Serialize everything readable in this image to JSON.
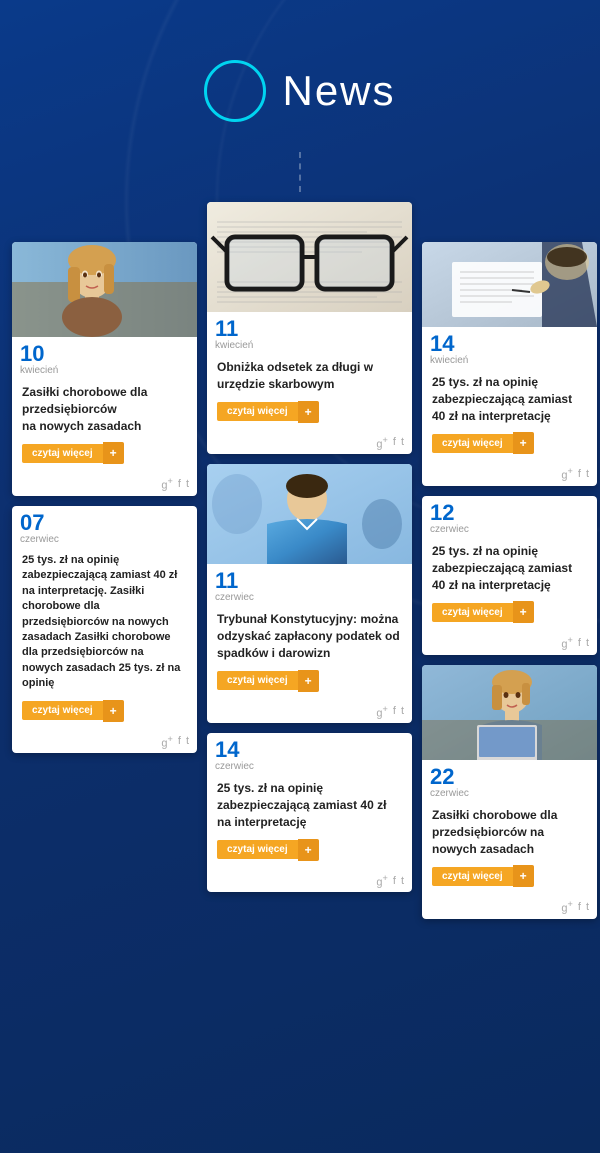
{
  "header": {
    "title": "News",
    "circle_color": "#00c8e0"
  },
  "cards": {
    "card1": {
      "day": "10",
      "month": "kwiecień",
      "title": "Zasiłki chorobowe dla przedsiębiorców na nowych zasadach",
      "read_more": "czytaj więcej",
      "plus": "+",
      "socials": [
        "g+",
        "f",
        "t"
      ]
    },
    "card2": {
      "day": "11",
      "month": "kwiecień",
      "title": "Obniżka odsetek za długi w urzędzie skarbowym",
      "read_more": "czytaj więcej",
      "plus": "+",
      "socials": [
        "g+",
        "f",
        "t"
      ]
    },
    "card3": {
      "day": "14",
      "month": "kwiecień",
      "title": "25 tys. zł na opinię zabezpieczającą zamiast 40 zł na interpretację",
      "read_more": "czytaj więcej",
      "plus": "+",
      "socials": [
        "g+",
        "f",
        "t"
      ]
    },
    "card4": {
      "day": "07",
      "month": "czerwiec",
      "title": "25 tys. zł na opinię zabezpieczającą zamiast 40 zł na interpretację. Zasiłki chorobowe dla przedsiębiorców na nowych zasadach Zasiłki chorobowe dla przedsiębiorców na nowych zasadach 25 tys. zł na opinię",
      "read_more": "czytaj więcej",
      "plus": "+",
      "socials": [
        "g+",
        "f",
        "t"
      ]
    },
    "card5": {
      "day": "11",
      "month": "czerwiec",
      "title": "Trybunał Konstytucyjny: można odzyskać zapłacony podatek od spadków i darowizn",
      "read_more": "czytaj więcej",
      "plus": "+",
      "socials": [
        "g+",
        "f",
        "t"
      ]
    },
    "card6": {
      "day": "12",
      "month": "czerwiec",
      "title": "25 tys. zł na opinię zabezpieczającą zamiast 40 zł na interpretację",
      "read_more": "czytaj więcej",
      "plus": "+",
      "socials": [
        "g+",
        "f",
        "t"
      ]
    },
    "card7": {
      "day": "14",
      "month": "czerwiec",
      "title": "25 tys. zł na opinię zabezpieczającą zamiast 40 zł na interpretację",
      "read_more": "czytaj więcej",
      "plus": "+",
      "socials": [
        "g+",
        "f",
        "t"
      ]
    },
    "card8": {
      "day": "22",
      "month": "czerwiec",
      "title": "Zasiłki chorobowe dla przedsiębiorców na nowych zasadach",
      "read_more": "czytaj więcej",
      "plus": "+",
      "socials": [
        "g+",
        "f",
        "t"
      ]
    }
  }
}
